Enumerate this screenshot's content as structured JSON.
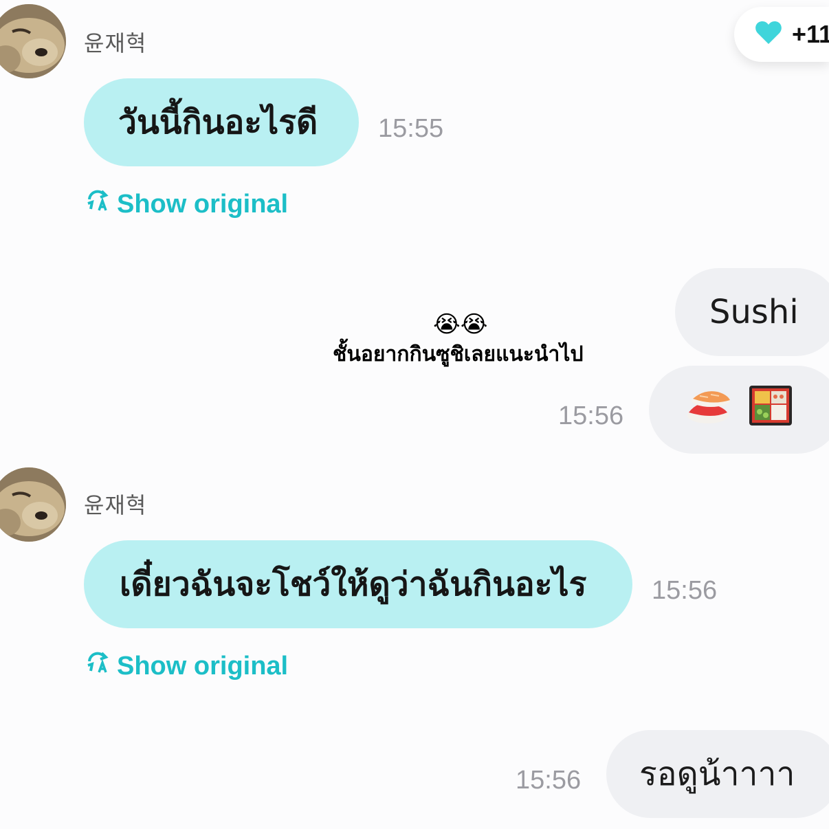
{
  "reaction": {
    "icon": "heart-icon",
    "count": "+11",
    "color": "#3fd5db"
  },
  "messages": [
    {
      "sender": "윤재혁",
      "text": "วันนี้กินอะไรดี",
      "time": "15:55",
      "show_original": "Show original"
    },
    {
      "text": "Sushi"
    },
    {
      "time": "15:56",
      "emoji": [
        "sushi-icon",
        "bento-box-icon"
      ]
    },
    {
      "sender": "윤재혁",
      "text": "เดี๋ยวฉันจะโชว์ให้ดูว่าฉันกินอะไร",
      "time": "15:56",
      "show_original": "Show original"
    },
    {
      "text": "รอดูน้าาาา",
      "time": "15:56"
    }
  ],
  "caption": {
    "emoji": "😭😭",
    "text": "ชั้นอยากกินซูชิเลยแนะนำไป"
  },
  "colors": {
    "incoming_bubble": "#b9f0f2",
    "outgoing_bubble": "#eff0f3",
    "accent": "#1cbec7"
  }
}
